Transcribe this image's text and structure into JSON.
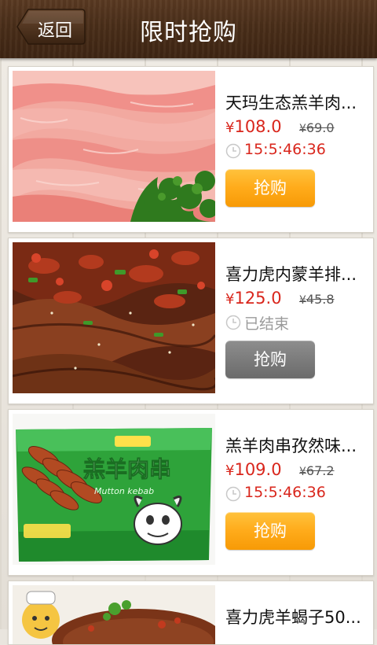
{
  "header": {
    "back_label": "返回",
    "title": "限时抢购"
  },
  "products": [
    {
      "name": "天玛生态羔羊肉...",
      "currency": "¥",
      "price": "108.0",
      "old_currency": "¥",
      "old_price": "69.0",
      "timer": "15:5:46:36",
      "status": "active",
      "button": "抢购"
    },
    {
      "name": "喜力虎内蒙羊排...",
      "currency": "¥",
      "price": "125.0",
      "old_currency": "¥",
      "old_price": "45.8",
      "timer": "已结束",
      "status": "ended",
      "button": "抢购"
    },
    {
      "name": "羔羊肉串孜然味...",
      "currency": "¥",
      "price": "109.0",
      "old_currency": "¥",
      "old_price": "67.2",
      "timer": "15:5:46:36",
      "status": "active",
      "button": "抢购"
    },
    {
      "name": "喜力虎羊蝎子50...",
      "currency": "",
      "price": "",
      "old_currency": "",
      "old_price": "",
      "timer": "",
      "status": "",
      "button": ""
    }
  ],
  "package_text": {
    "headline": "羔羊肉串",
    "subline": "Mutton kebab"
  },
  "colors": {
    "price_red": "#d9261c",
    "button_orange": "#ffab1a",
    "button_gray": "#7c7c7c",
    "header_brown": "#4a2e19"
  }
}
